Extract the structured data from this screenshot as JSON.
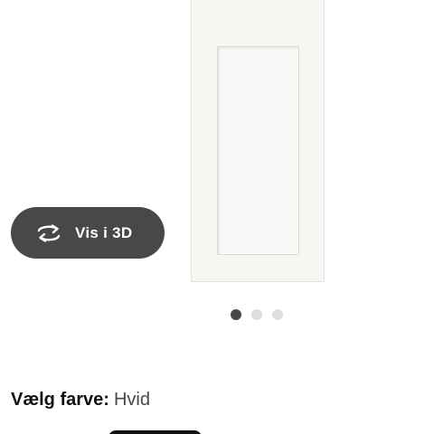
{
  "viewer": {
    "view_3d_label": "Vis i 3D",
    "view_3d_icon": "rotate-3d-icon",
    "slides": [
      {
        "active": true
      },
      {
        "active": false
      },
      {
        "active": false
      }
    ]
  },
  "color_selector": {
    "label": "Vælg farve:",
    "value": "Hvid"
  },
  "colors": {
    "button_bg": "#484848",
    "dot_active": "#484848",
    "dot_inactive": "#dfdfdf"
  }
}
